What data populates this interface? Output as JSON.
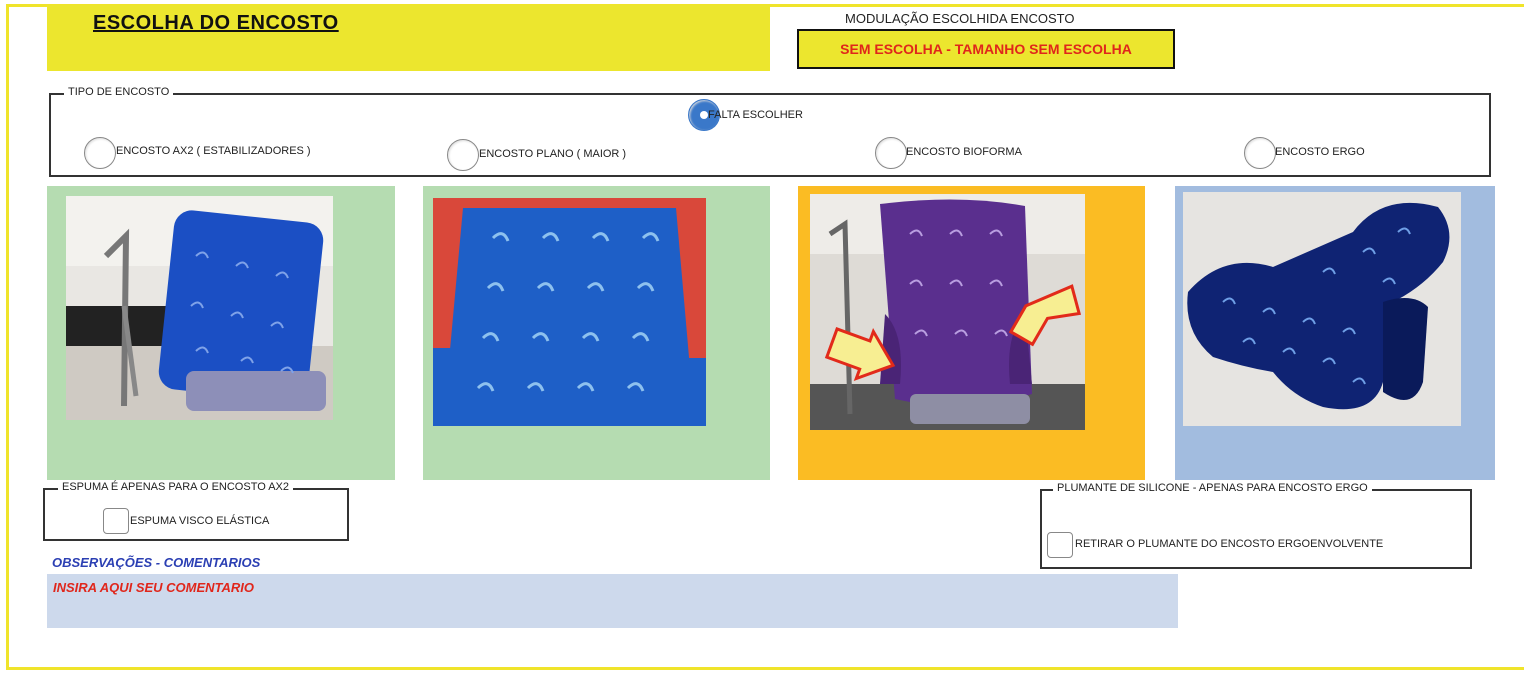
{
  "header": {
    "title": "ESCOLHA  DO  ENCOSTO",
    "modulation_label": "MODULAÇÃO ESCOLHIDA ENCOSTO",
    "modulation_value": "SEM ESCOLHA - TAMANHO SEM ESCOLHA"
  },
  "backrest_type": {
    "legend": "TIPO DE ENCOSTO",
    "options": [
      {
        "label": "FALTA ESCOLHER",
        "checked": true
      },
      {
        "label": "ENCOSTO AX2  ( ESTABILIZADORES )",
        "checked": false
      },
      {
        "label": "ENCOSTO PLANO (  MAIOR  )",
        "checked": false
      },
      {
        "label": "ENCOSTO BIOFORMA",
        "checked": false
      },
      {
        "label": "ENCOSTO ERGO",
        "checked": false
      }
    ]
  },
  "colors": {
    "yellow": "#ece62e",
    "green_panel": "#b5dcb1",
    "orange_panel": "#fbbc23",
    "blue_panel": "#a2bcdf",
    "red_text": "#e0261b",
    "blue_text": "#2b3fb3",
    "comment_bg": "#cdd9ec",
    "radio_selected": "#3a78c9"
  },
  "foam": {
    "legend": "ESPUMA É APENAS PARA O ENCOSTO AX2",
    "checkbox_label": "ESPUMA VISCO ELÁSTICA",
    "checked": false
  },
  "plumante": {
    "legend": "PLUMANTE DE SILICONE - APENAS PARA ENCOSTO ERGO",
    "checkbox_label": "RETIRAR O PLUMANTE DO ENCOSTO ERGOENVOLVENTE",
    "checked": false
  },
  "observations": {
    "label": "OBSERVAÇÕES  - COMENTARIOS",
    "placeholder": "INSIRA AQUI SEU COMENTARIO"
  }
}
